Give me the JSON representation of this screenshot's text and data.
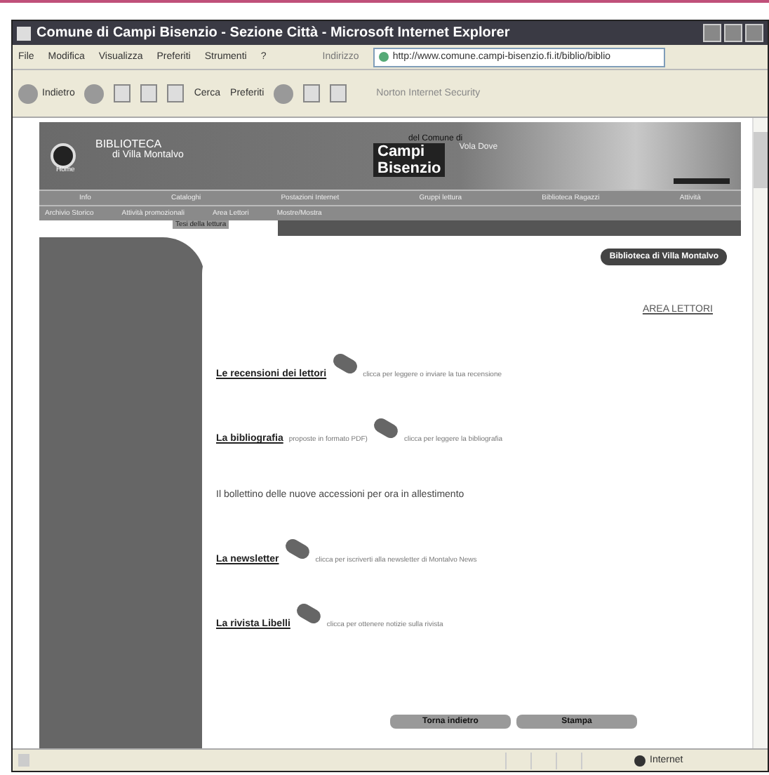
{
  "window": {
    "title": "Comune di Campi Bisenzio - Sezione Città - Microsoft Internet Explorer"
  },
  "menu": [
    "File",
    "Modifica",
    "Visualizza",
    "Preferiti",
    "Strumenti",
    "?"
  ],
  "address": {
    "label": "Indirizzo",
    "value": "http://www.comune.campi-bisenzio.fi.it/biblio/biblio"
  },
  "toolbar": {
    "back": "Indietro",
    "search": "Cerca",
    "favorites": "Preferiti",
    "extra": "Norton Internet Security"
  },
  "banner": {
    "library": "BIBLIOTECA",
    "place": "di Villa Montalvo",
    "home": "Home",
    "comune": "del Comune di",
    "city_1": "Campi",
    "city_2": "Bisenzio",
    "tagline": "Vola Dove"
  },
  "nav_rows": [
    [
      "Info",
      "Cataloghi",
      "Postazioni Internet",
      "Gruppi lettura",
      "Biblioteca Ragazzi",
      "Attività"
    ],
    [
      "Archivio Storico",
      "Attività promozionali",
      "Area Lettori",
      "Mostre/Mostra"
    ]
  ],
  "nav_sub": "Tesi della lettura",
  "badge": "Biblioteca di Villa Montalvo",
  "section_title": "AREA LETTORI",
  "entries": [
    {
      "kind": "link",
      "link": "Le recensioni dei lettori",
      "action": "clicca per leggere o inviare la tua recensione"
    },
    {
      "kind": "link",
      "link": "La bibliografia",
      "note": "proposte in formato PDF)",
      "action": "clicca per leggere la bibliografia"
    },
    {
      "kind": "text",
      "note": "Il bollettino delle nuove accessioni per ora in allestimento"
    },
    {
      "kind": "link",
      "link": "La newsletter",
      "action": "clicca per iscriverti alla newsletter di Montalvo News"
    },
    {
      "kind": "link",
      "link": "La rivista Libelli",
      "action": "clicca per ottenere notizie sulla rivista"
    }
  ],
  "buttons": [
    "Torna indietro",
    "Stampa"
  ],
  "status_bar": {
    "zone": "Internet"
  }
}
